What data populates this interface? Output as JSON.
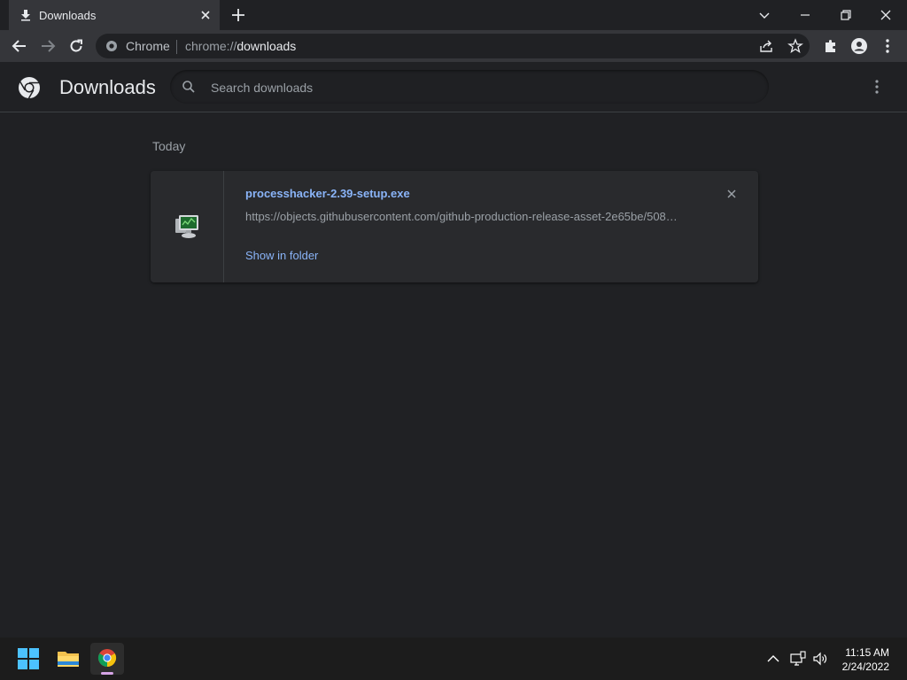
{
  "tab": {
    "title": "Downloads"
  },
  "omnibox": {
    "site_chip": "Chrome",
    "url_prefix": "chrome://",
    "url_host": "downloads"
  },
  "page": {
    "title": "Downloads",
    "search_placeholder": "Search downloads"
  },
  "downloads": {
    "section_date": "Today",
    "items": [
      {
        "file_name": "processhacker-2.39-setup.exe",
        "url": "https://objects.githubusercontent.com/github-production-release-asset-2e65be/508…",
        "action_label": "Show in folder"
      }
    ]
  },
  "taskbar": {
    "time": "11:15 AM",
    "date": "2/24/2022"
  },
  "colors": {
    "accent": "#8ab4f8",
    "background": "#202124",
    "toolbar": "#35363a"
  }
}
